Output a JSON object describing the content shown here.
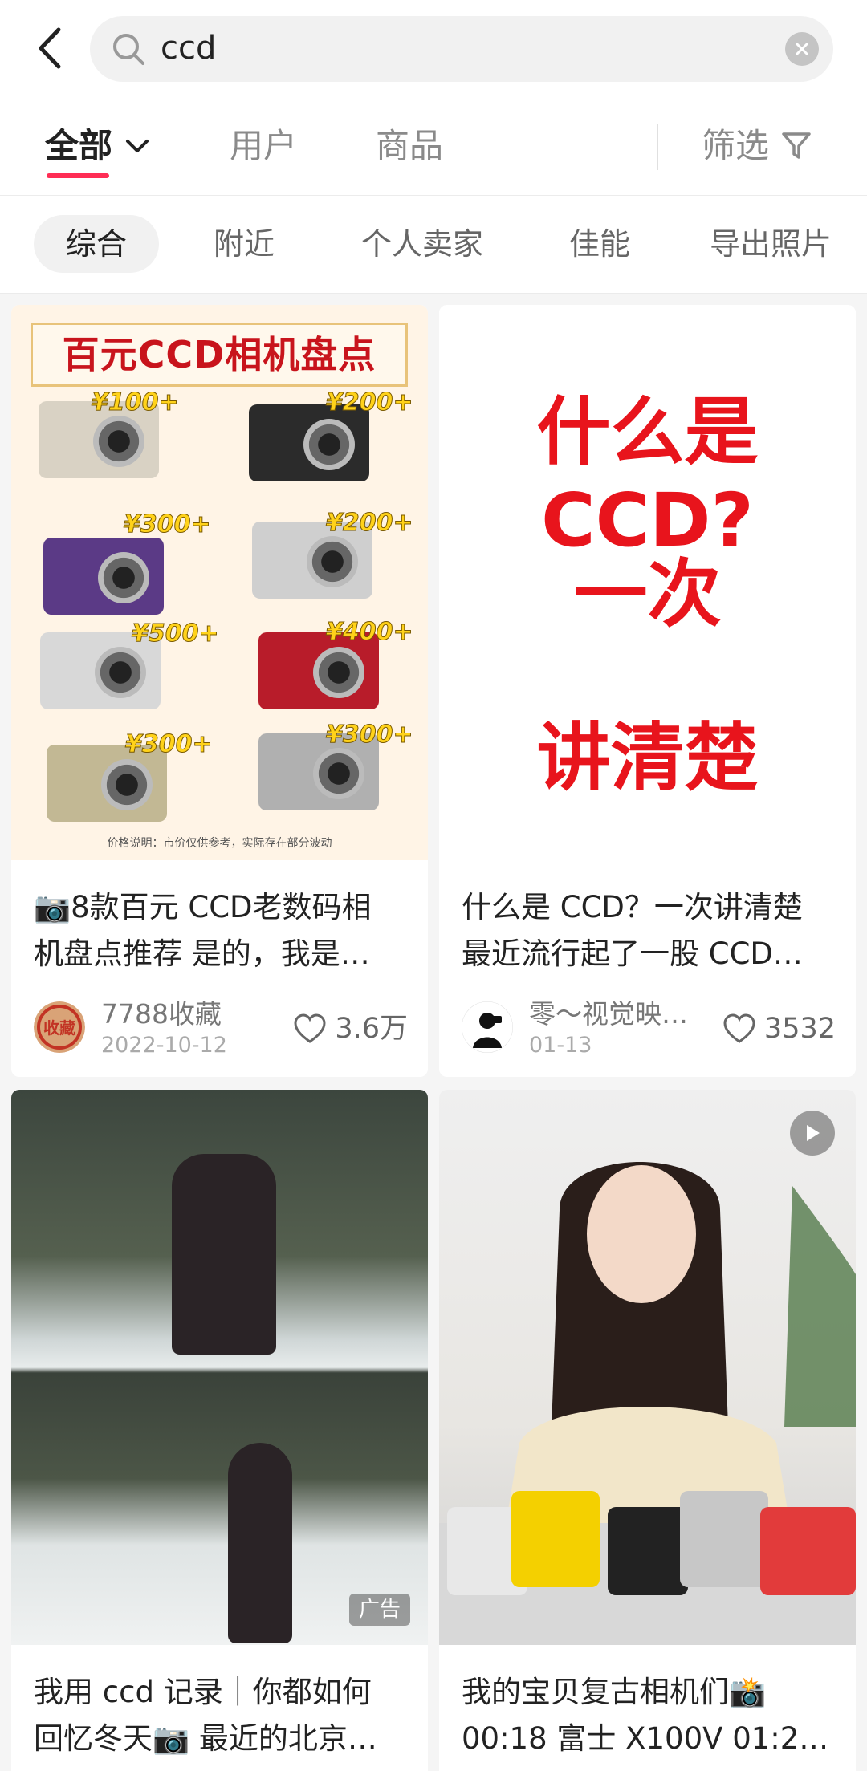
{
  "search": {
    "query": "ccd"
  },
  "tabs": [
    {
      "label": "全部"
    },
    {
      "label": "用户"
    },
    {
      "label": "商品"
    }
  ],
  "filter": {
    "label": "筛选"
  },
  "chips": [
    "综合",
    "附近",
    "个人卖家",
    "佳能",
    "导出照片"
  ],
  "cards": [
    {
      "title_line1": "📷8款百元 CCD老数码相",
      "title_line2": "机盘点推荐 是的，我是…",
      "author": "7788收藏",
      "avatar_text": "收藏",
      "date": "2022-10-12",
      "likes": "3.6万",
      "cover": {
        "banner": "百元CCD相机盘点",
        "prices": [
          "¥100+",
          "¥200+",
          "¥300+",
          "¥200+",
          "¥500+",
          "¥400+",
          "¥300+",
          "¥300+"
        ],
        "note": "价格说明：市价仅供参考，实际存在部分波动"
      }
    },
    {
      "title_line1": "什么是 CCD？一次讲清楚",
      "title_line2": "最近流行起了一股 CCD…",
      "author": "零～视觉映…",
      "date": "01-13",
      "likes": "3532",
      "cover": {
        "line1": "什么是CCD?",
        "line2": "一次",
        "line3": "讲清楚"
      }
    },
    {
      "title_line1": "我用 ccd 记录｜你都如何",
      "title_line2": "回忆冬天📷 最近的北京…",
      "ad_label": "广告"
    },
    {
      "title_line1": "我的宝贝复古相机们📸",
      "title_line2": "00:18 富士 X100V 01:2…"
    }
  ],
  "colors": {
    "accent": "#ff2d55",
    "cover_red": "#e8141c"
  }
}
